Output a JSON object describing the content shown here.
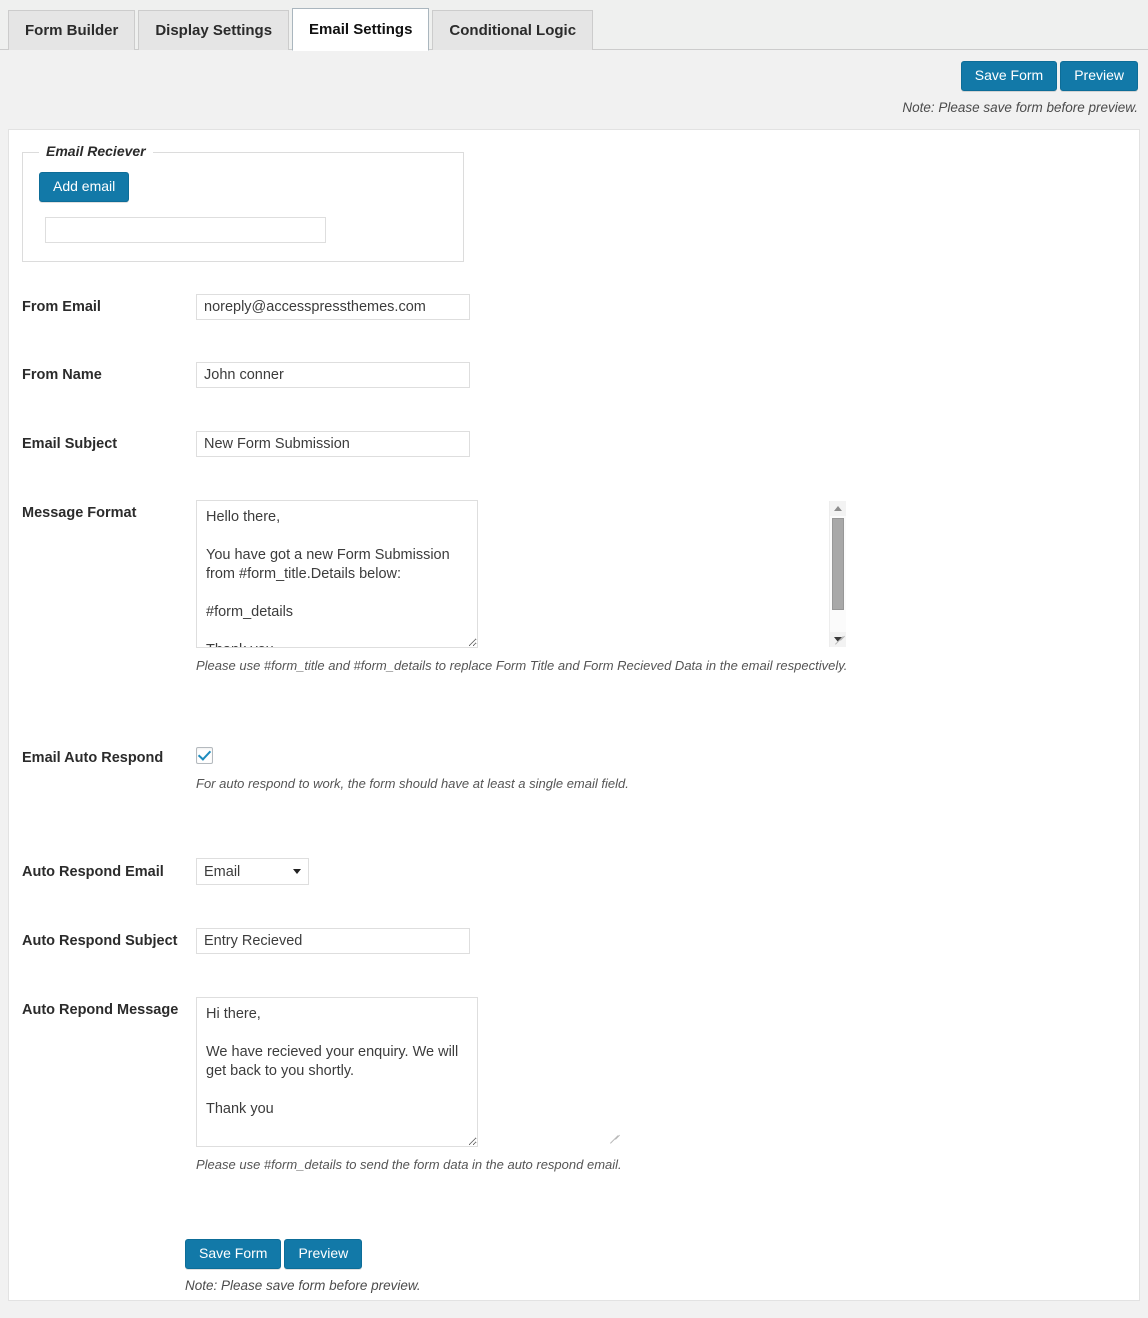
{
  "tabs": [
    {
      "label": "Form Builder",
      "active": false
    },
    {
      "label": "Display Settings",
      "active": false
    },
    {
      "label": "Email Settings",
      "active": true
    },
    {
      "label": "Conditional Logic",
      "active": false
    }
  ],
  "toolbar": {
    "save_label": "Save Form",
    "preview_label": "Preview",
    "note": "Note: Please save form before preview."
  },
  "email_receiver": {
    "legend": "Email Reciever",
    "add_button_label": "Add email",
    "input_value": "",
    "input_placeholder": ""
  },
  "fields": {
    "from_email": {
      "label": "From Email",
      "value": "noreply@accesspressthemes.com"
    },
    "from_name": {
      "label": "From Name",
      "value": "John conner"
    },
    "email_subject": {
      "label": "Email Subject",
      "value": "New Form Submission"
    },
    "message_format": {
      "label": "Message Format",
      "value": "Hello there,\n\nYou have got a new Form Submission from #form_title.Details below:\n\n#form_details\n\nThank you",
      "helper": "Please use #form_title and #form_details to replace Form Title and Form Recieved Data in the email respectively."
    },
    "email_auto_respond": {
      "label": "Email Auto Respond",
      "checked": true,
      "helper": "For auto respond to work, the form should have at least a single email field."
    },
    "auto_respond_email": {
      "label": "Auto Respond Email",
      "selected": "Email",
      "options": [
        "Email"
      ]
    },
    "auto_respond_subject": {
      "label": "Auto Respond Subject",
      "value": "Entry Recieved"
    },
    "auto_respond_message": {
      "label": "Auto Repond Message",
      "value": "Hi there,\n\nWe have recieved your enquiry. We will get back to you shortly.\n\nThank you",
      "helper": "Please use #form_details to send the form data in the auto respond email."
    }
  },
  "bottom": {
    "save_label": "Save Form",
    "preview_label": "Preview",
    "note": "Note: Please save form before preview."
  },
  "colors": {
    "accent": "#1279a8",
    "checkbox_check": "#1e8cbe",
    "page_bg": "#f1f1f1",
    "panel_bg": "#ffffff"
  }
}
